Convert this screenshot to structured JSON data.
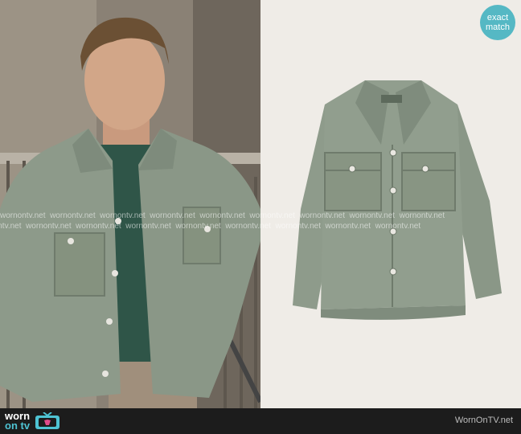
{
  "badge": {
    "line1": "exact",
    "line2": "match"
  },
  "watermark": {
    "text": "wornontv.net"
  },
  "footer": {
    "logo_line1": "worn",
    "logo_line2": "on tv",
    "brand_text": "WornOnTV.net"
  },
  "colors": {
    "badge": "#55b8c4",
    "jacket_green": "#8d9a8a",
    "footer_bg": "#1c1c1c"
  },
  "icons": [
    "tv-icon"
  ]
}
